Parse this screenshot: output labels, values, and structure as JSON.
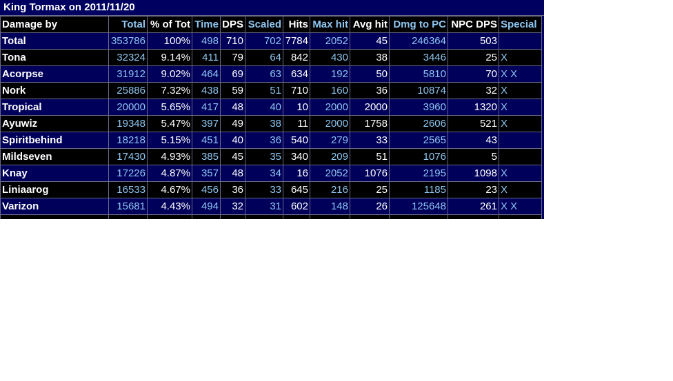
{
  "title": "King Tormax on 2011/11/20",
  "headers": [
    "Damage by",
    "Total",
    "% of Tot",
    "Time",
    "DPS",
    "Scaled",
    "Hits",
    "Max hit",
    "Avg hit",
    "Dmg to PC",
    "NPC DPS",
    "Special"
  ],
  "rows": [
    [
      "Total",
      "353786",
      "100%",
      "498",
      "710",
      "702",
      "7784",
      "2052",
      "45",
      "246364",
      "503",
      ""
    ],
    [
      "Tona",
      "32324",
      "9.14%",
      "411",
      "79",
      "64",
      "842",
      "430",
      "38",
      "3446",
      "25",
      "X"
    ],
    [
      "Acorpse",
      "31912",
      "9.02%",
      "464",
      "69",
      "63",
      "634",
      "192",
      "50",
      "5810",
      "70",
      "X X"
    ],
    [
      "Nork",
      "25886",
      "7.32%",
      "438",
      "59",
      "51",
      "710",
      "160",
      "36",
      "10874",
      "32",
      "X"
    ],
    [
      "Tropical",
      "20000",
      "5.65%",
      "417",
      "48",
      "40",
      "10",
      "2000",
      "2000",
      "3960",
      "1320",
      "X"
    ],
    [
      "Ayuwiz",
      "19348",
      "5.47%",
      "397",
      "49",
      "38",
      "11",
      "2000",
      "1758",
      "2606",
      "521",
      "X"
    ],
    [
      "Spiritbehind",
      "18218",
      "5.15%",
      "451",
      "40",
      "36",
      "540",
      "279",
      "33",
      "2565",
      "43",
      ""
    ],
    [
      "Mildseven",
      "17430",
      "4.93%",
      "385",
      "45",
      "35",
      "340",
      "209",
      "51",
      "1076",
      "5",
      ""
    ],
    [
      "Knay",
      "17226",
      "4.87%",
      "357",
      "48",
      "34",
      "16",
      "2052",
      "1076",
      "2195",
      "1098",
      "X"
    ],
    [
      "Liniaarog",
      "16533",
      "4.67%",
      "456",
      "36",
      "33",
      "645",
      "216",
      "25",
      "1185",
      "23",
      "X"
    ],
    [
      "Varizon",
      "15681",
      "4.43%",
      "494",
      "32",
      "31",
      "602",
      "148",
      "26",
      "125648",
      "261",
      "X X"
    ]
  ],
  "colors": {
    "accent": "#8ec6f0",
    "row_blue": "#00005a",
    "row_black": "#000000",
    "border": "#6a6a8a"
  }
}
